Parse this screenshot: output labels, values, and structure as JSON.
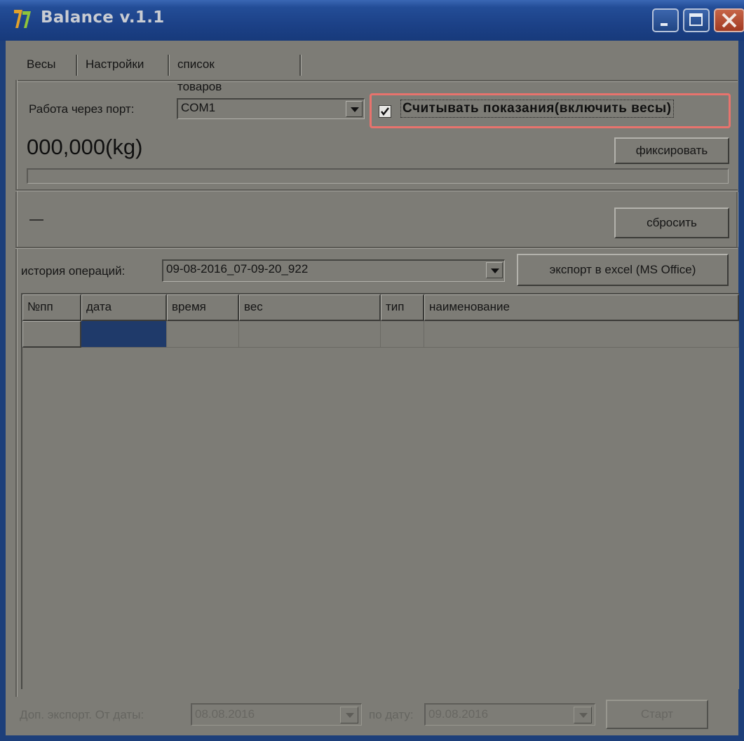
{
  "window": {
    "title": "Balance v.1.1"
  },
  "tabs": [
    {
      "label": "Весы"
    },
    {
      "label": "Настройки"
    },
    {
      "label": "список товаров"
    }
  ],
  "port": {
    "label": "Работа через порт:",
    "value": "COM1"
  },
  "read_checkbox": {
    "label": "Считывать показания(включить весы)",
    "checked": true
  },
  "weight": {
    "value": "000,000(kg)"
  },
  "fix_button": {
    "label": "фиксировать"
  },
  "status": {
    "text": "—"
  },
  "reset_button": {
    "label": "сбросить"
  },
  "history": {
    "label": "история операций:",
    "value": "09-08-2016_07-09-20_922"
  },
  "export_button": {
    "label": "экспорт в excel (MS Office)"
  },
  "table": {
    "columns": [
      "№пп",
      "дата",
      "время",
      "вес",
      "тип",
      "наименование"
    ],
    "rows": [
      [
        "",
        "",
        "",
        "",
        "",
        ""
      ]
    ]
  },
  "footer": {
    "export_label": "Доп. экспорт. От даты:",
    "from_date": "08.08.2016",
    "to_label": "по дату:",
    "to_date": "09.08.2016",
    "start_button": "Старт"
  },
  "colors": {
    "titlebar": "#1c4187",
    "window_bg": "#7d7c76",
    "selected_cell": "#1f3a6a",
    "highlight": "#e8736d"
  }
}
